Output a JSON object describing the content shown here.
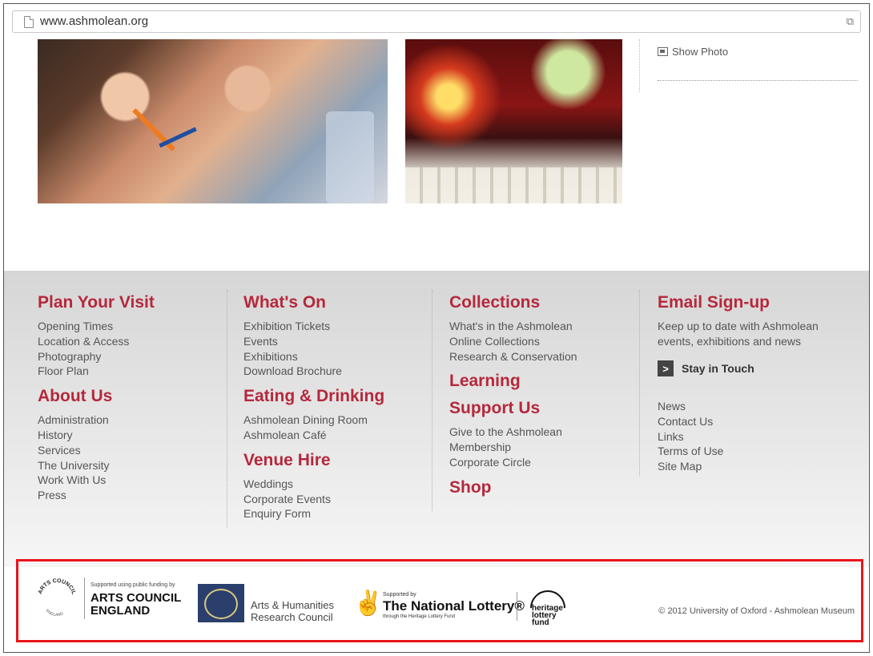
{
  "browser": {
    "url": "www.ashmolean.org"
  },
  "sidebar": {
    "show_photo": "Show Photo"
  },
  "footer": {
    "columns": [
      {
        "sections": [
          {
            "title": "Plan Your Visit",
            "links": [
              "Opening Times",
              "Location & Access",
              "Photography",
              "Floor Plan"
            ]
          },
          {
            "title": "About Us",
            "links": [
              "Administration",
              "History",
              "Services",
              "The University",
              "Work With Us",
              "Press"
            ]
          }
        ]
      },
      {
        "sections": [
          {
            "title": "What's On",
            "links": [
              "Exhibition Tickets",
              "Events",
              "Exhibitions",
              "Download Brochure"
            ]
          },
          {
            "title": "Eating & Drinking",
            "links": [
              "Ashmolean Dining Room",
              "Ashmolean Café"
            ]
          },
          {
            "title": "Venue Hire",
            "links": [
              "Weddings",
              "Corporate Events",
              "Enquiry Form"
            ]
          }
        ]
      },
      {
        "sections": [
          {
            "title": "Collections",
            "links": [
              "What's in the Ashmolean",
              "Online Collections",
              "Research & Conservation"
            ]
          },
          {
            "title": "Learning",
            "links": []
          },
          {
            "title": "Support Us",
            "links": [
              "Give to the Ashmolean",
              "Membership",
              "Corporate Circle"
            ]
          },
          {
            "title": "Shop",
            "links": []
          }
        ]
      }
    ],
    "signup": {
      "title": "Email Sign-up",
      "text": "Keep up to date with Ashmolean events, exhibitions and news",
      "button_icon": ">",
      "button_label": "Stay in Touch",
      "links": [
        "News",
        "Contact Us",
        "Links",
        "Terms of Use",
        "Site Map"
      ]
    }
  },
  "logos": {
    "arts_council": {
      "ring_top": "ARTS COUNCIL",
      "ring_bottom": "ENGLAND",
      "small": "Supported using public funding by",
      "big_line1": "ARTS COUNCIL",
      "big_line2": "ENGLAND"
    },
    "ahrc": {
      "line1": "Arts & Humanities",
      "line2": "Research Council"
    },
    "national_lottery": {
      "small": "Supported by",
      "big": "The National Lottery®",
      "sub": "through the Heritage Lottery Fund"
    },
    "hlf": {
      "line1": "heritage",
      "line2": "lottery fund"
    },
    "copyright": "© 2012 University of Oxford - Ashmolean Museum"
  }
}
